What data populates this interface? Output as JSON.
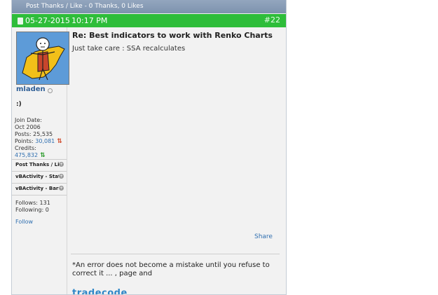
{
  "thanks_bar": {
    "label": "Post Thanks / Like - 0 Thanks, 0 Likes"
  },
  "post_header": {
    "date": "05-27-2015",
    "time": "10:17 PM",
    "post_number": "#22",
    "accent_color": "#2ebd3a"
  },
  "user": {
    "username": "mladen",
    "title": ":)",
    "join_date_label": "Join Date:",
    "join_date": "Oct 2006",
    "posts_label": "Posts:",
    "posts": "25,535",
    "points_label": "Points:",
    "points": "30,081",
    "credits_label": "Credits:",
    "credits": "475,832",
    "follows_label": "Follows:",
    "follows": "131",
    "following_label": "Following:",
    "following": "0",
    "follow_link": "Follow"
  },
  "sidebar_sections": [
    {
      "label": "Post Thanks / Like"
    },
    {
      "label": "vBActivity - Stats"
    },
    {
      "label": "vBActivity - Bars"
    }
  ],
  "post": {
    "title": "Re: Best indicators to work with Renko Charts",
    "message": "Just take care : SSA recalculates",
    "share_label": "Share",
    "signature": "*An error does not become a mistake until you refuse to correct it ... , page and",
    "signature_brand": "tradecode"
  }
}
